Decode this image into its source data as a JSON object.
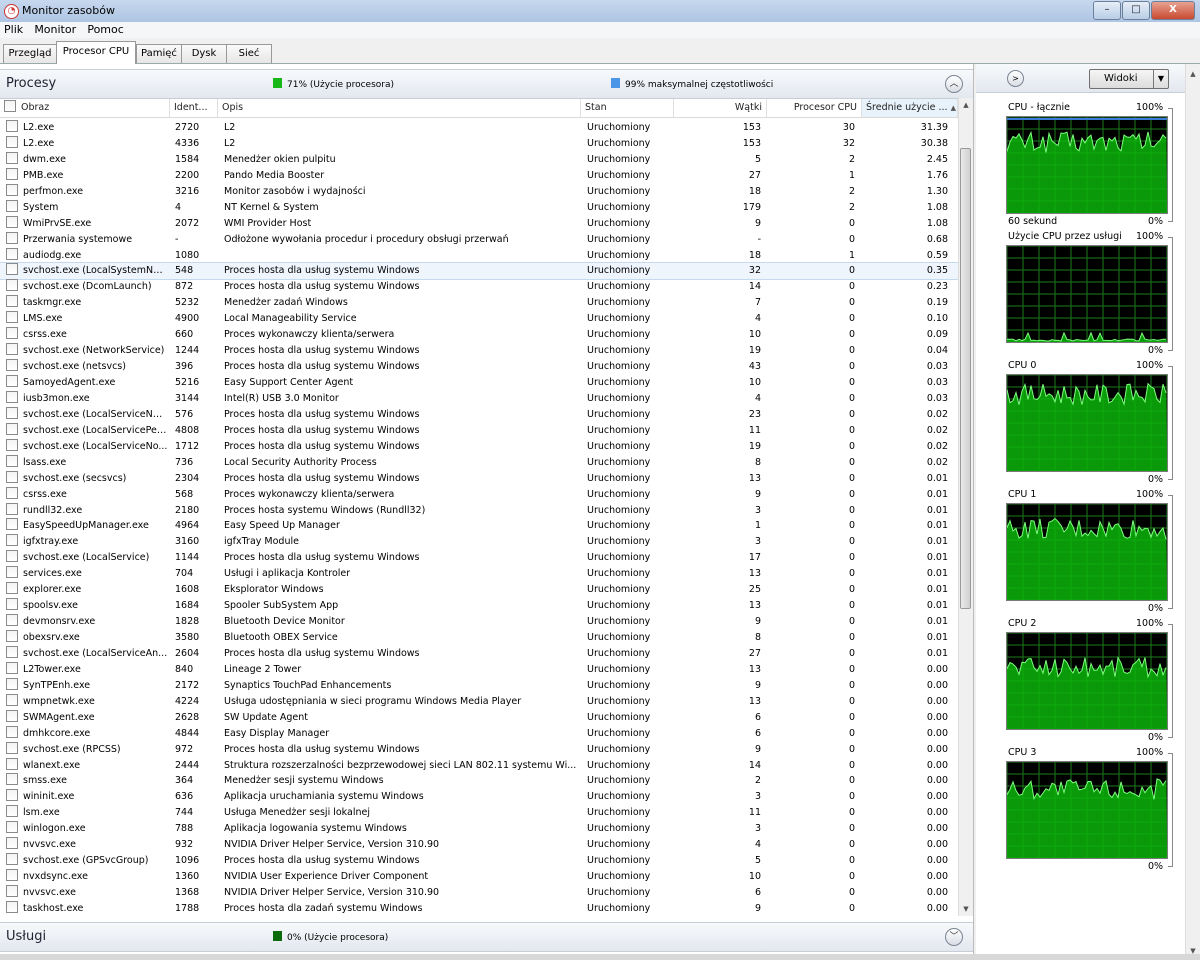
{
  "window": {
    "title": "Monitor zasobów",
    "minimize": "–",
    "maximize": "□",
    "close": "X"
  },
  "menu": [
    "Plik",
    "Monitor",
    "Pomoc"
  ],
  "tabs": [
    "Przegląd",
    "Procesor CPU",
    "Pamięć",
    "Dysk",
    "Sieć"
  ],
  "processes": {
    "title": "Procesy",
    "stat1": "71% (Użycie procesora)",
    "stat2": "99% maksymalnej częstotliwości",
    "stat1_color": "#17b817",
    "stat2_color": "#4b96e6",
    "columns": [
      "Obraz",
      "Ident...",
      "Opis",
      "Stan",
      "Wątki",
      "Procesor CPU",
      "Średnie użycie ..."
    ],
    "rows": [
      [
        "L2.exe",
        "2720",
        "L2",
        "Uruchomiony",
        "153",
        "30",
        "31.39"
      ],
      [
        "L2.exe",
        "4336",
        "L2",
        "Uruchomiony",
        "153",
        "32",
        "30.38"
      ],
      [
        "dwm.exe",
        "1584",
        "Menedżer okien pulpitu",
        "Uruchomiony",
        "5",
        "2",
        "2.45"
      ],
      [
        "PMB.exe",
        "2200",
        "Pando Media Booster",
        "Uruchomiony",
        "27",
        "1",
        "1.76"
      ],
      [
        "perfmon.exe",
        "3216",
        "Monitor zasobów i wydajności",
        "Uruchomiony",
        "18",
        "2",
        "1.30"
      ],
      [
        "System",
        "4",
        "NT Kernel & System",
        "Uruchomiony",
        "179",
        "2",
        "1.08"
      ],
      [
        "WmiPrvSE.exe",
        "2072",
        "WMI Provider Host",
        "Uruchomiony",
        "9",
        "0",
        "1.08"
      ],
      [
        "Przerwania systemowe",
        "-",
        "Odłożone wywołania procedur i procedury obsługi przerwań",
        "Uruchomiony",
        "-",
        "0",
        "0.68"
      ],
      [
        "audiodg.exe",
        "1080",
        "",
        "Uruchomiony",
        "18",
        "1",
        "0.59"
      ],
      [
        "svchost.exe (LocalSystemNet...",
        "548",
        "Proces hosta dla usług systemu Windows",
        "Uruchomiony",
        "32",
        "0",
        "0.35"
      ],
      [
        "svchost.exe (DcomLaunch)",
        "872",
        "Proces hosta dla usług systemu Windows",
        "Uruchomiony",
        "14",
        "0",
        "0.23"
      ],
      [
        "taskmgr.exe",
        "5232",
        "Menedżer zadań Windows",
        "Uruchomiony",
        "7",
        "0",
        "0.19"
      ],
      [
        "LMS.exe",
        "4900",
        "Local Manageability Service",
        "Uruchomiony",
        "4",
        "0",
        "0.10"
      ],
      [
        "csrss.exe",
        "660",
        "Proces wykonawczy klienta/serwera",
        "Uruchomiony",
        "10",
        "0",
        "0.09"
      ],
      [
        "svchost.exe (NetworkService)",
        "1244",
        "Proces hosta dla usług systemu Windows",
        "Uruchomiony",
        "19",
        "0",
        "0.04"
      ],
      [
        "svchost.exe (netsvcs)",
        "396",
        "Proces hosta dla usług systemu Windows",
        "Uruchomiony",
        "43",
        "0",
        "0.03"
      ],
      [
        "SamoyedAgent.exe",
        "5216",
        "Easy Support Center Agent",
        "Uruchomiony",
        "10",
        "0",
        "0.03"
      ],
      [
        "iusb3mon.exe",
        "3144",
        "Intel(R) USB 3.0 Monitor",
        "Uruchomiony",
        "4",
        "0",
        "0.03"
      ],
      [
        "svchost.exe (LocalServiceNet...",
        "576",
        "Proces hosta dla usług systemu Windows",
        "Uruchomiony",
        "23",
        "0",
        "0.02"
      ],
      [
        "svchost.exe (LocalServicePee...",
        "4808",
        "Proces hosta dla usług systemu Windows",
        "Uruchomiony",
        "11",
        "0",
        "0.02"
      ],
      [
        "svchost.exe (LocalServiceNo...",
        "1712",
        "Proces hosta dla usług systemu Windows",
        "Uruchomiony",
        "19",
        "0",
        "0.02"
      ],
      [
        "lsass.exe",
        "736",
        "Local Security Authority Process",
        "Uruchomiony",
        "8",
        "0",
        "0.02"
      ],
      [
        "svchost.exe (secsvcs)",
        "2304",
        "Proces hosta dla usług systemu Windows",
        "Uruchomiony",
        "13",
        "0",
        "0.01"
      ],
      [
        "csrss.exe",
        "568",
        "Proces wykonawczy klienta/serwera",
        "Uruchomiony",
        "9",
        "0",
        "0.01"
      ],
      [
        "rundll32.exe",
        "2180",
        "Proces hosta systemu Windows (Rundll32)",
        "Uruchomiony",
        "3",
        "0",
        "0.01"
      ],
      [
        "EasySpeedUpManager.exe",
        "4964",
        "Easy Speed Up Manager",
        "Uruchomiony",
        "1",
        "0",
        "0.01"
      ],
      [
        "igfxtray.exe",
        "3160",
        "igfxTray Module",
        "Uruchomiony",
        "3",
        "0",
        "0.01"
      ],
      [
        "svchost.exe (LocalService)",
        "1144",
        "Proces hosta dla usług systemu Windows",
        "Uruchomiony",
        "17",
        "0",
        "0.01"
      ],
      [
        "services.exe",
        "704",
        "Usługi i aplikacja Kontroler",
        "Uruchomiony",
        "13",
        "0",
        "0.01"
      ],
      [
        "explorer.exe",
        "1608",
        "Eksplorator Windows",
        "Uruchomiony",
        "25",
        "0",
        "0.01"
      ],
      [
        "spoolsv.exe",
        "1684",
        "Spooler SubSystem App",
        "Uruchomiony",
        "13",
        "0",
        "0.01"
      ],
      [
        "devmonsrv.exe",
        "1828",
        "Bluetooth Device Monitor",
        "Uruchomiony",
        "9",
        "0",
        "0.01"
      ],
      [
        "obexsrv.exe",
        "3580",
        "Bluetooth OBEX Service",
        "Uruchomiony",
        "8",
        "0",
        "0.01"
      ],
      [
        "svchost.exe (LocalServiceAn...",
        "2604",
        "Proces hosta dla usług systemu Windows",
        "Uruchomiony",
        "27",
        "0",
        "0.01"
      ],
      [
        "L2Tower.exe",
        "840",
        "Lineage 2 Tower",
        "Uruchomiony",
        "13",
        "0",
        "0.00"
      ],
      [
        "SynTPEnh.exe",
        "2172",
        "Synaptics TouchPad Enhancements",
        "Uruchomiony",
        "9",
        "0",
        "0.00"
      ],
      [
        "wmpnetwk.exe",
        "4224",
        "Usługa udostępniania w sieci programu Windows Media Player",
        "Uruchomiony",
        "13",
        "0",
        "0.00"
      ],
      [
        "SWMAgent.exe",
        "2628",
        "SW Update Agent",
        "Uruchomiony",
        "6",
        "0",
        "0.00"
      ],
      [
        "dmhkcore.exe",
        "4844",
        "Easy Display Manager",
        "Uruchomiony",
        "6",
        "0",
        "0.00"
      ],
      [
        "svchost.exe (RPCSS)",
        "972",
        "Proces hosta dla usług systemu Windows",
        "Uruchomiony",
        "9",
        "0",
        "0.00"
      ],
      [
        "wlanext.exe",
        "2444",
        "Struktura rozszerzalności bezprzewodowej sieci LAN 802.11 systemu Wi...",
        "Uruchomiony",
        "14",
        "0",
        "0.00"
      ],
      [
        "smss.exe",
        "364",
        "Menedżer sesji systemu Windows",
        "Uruchomiony",
        "2",
        "0",
        "0.00"
      ],
      [
        "wininit.exe",
        "636",
        "Aplikacja uruchamiania systemu Windows",
        "Uruchomiony",
        "3",
        "0",
        "0.00"
      ],
      [
        "lsm.exe",
        "744",
        "Usługa Menedżer sesji lokalnej",
        "Uruchomiony",
        "11",
        "0",
        "0.00"
      ],
      [
        "winlogon.exe",
        "788",
        "Aplikacja logowania systemu Windows",
        "Uruchomiony",
        "3",
        "0",
        "0.00"
      ],
      [
        "nvvsvc.exe",
        "932",
        "NVIDIA Driver Helper Service, Version 310.90",
        "Uruchomiony",
        "4",
        "0",
        "0.00"
      ],
      [
        "svchost.exe (GPSvcGroup)",
        "1096",
        "Proces hosta dla usług systemu Windows",
        "Uruchomiony",
        "5",
        "0",
        "0.00"
      ],
      [
        "nvxdsync.exe",
        "1360",
        "NVIDIA User Experience Driver Component",
        "Uruchomiony",
        "10",
        "0",
        "0.00"
      ],
      [
        "nvvsvc.exe",
        "1368",
        "NVIDIA Driver Helper Service, Version 310.90",
        "Uruchomiony",
        "6",
        "0",
        "0.00"
      ],
      [
        "taskhost.exe",
        "1788",
        "Proces hosta dla zadań systemu Windows",
        "Uruchomiony",
        "9",
        "0",
        "0.00"
      ]
    ]
  },
  "services": {
    "title": "Usługi",
    "stat": "0% (Użycie procesora)",
    "stat_color": "#0b6b0b"
  },
  "right_panel": {
    "views_label": "Widoki",
    "graphs": [
      {
        "name": "CPU - łącznie",
        "top": "100%",
        "bottom": "0%",
        "caption": "60 sekund",
        "level": 0.74
      },
      {
        "name": "Użycie CPU przez usługi",
        "top": "100%",
        "bottom": "0%",
        "caption": "",
        "level": 0.02
      },
      {
        "name": "CPU 0",
        "top": "100%",
        "bottom": "0%",
        "caption": "",
        "level": 0.8
      },
      {
        "name": "CPU 1",
        "top": "100%",
        "bottom": "0%",
        "caption": "",
        "level": 0.74
      },
      {
        "name": "CPU 2",
        "top": "100%",
        "bottom": "0%",
        "caption": "",
        "level": 0.65
      },
      {
        "name": "CPU 3",
        "top": "100%",
        "bottom": "0%",
        "caption": "",
        "level": 0.72
      }
    ]
  }
}
